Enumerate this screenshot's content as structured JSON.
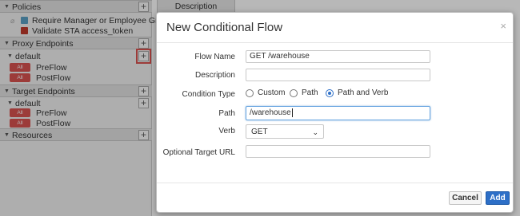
{
  "sidebar": {
    "policies_header": "Policies",
    "policies": [
      {
        "label": "Require Manager or Employee Gr...",
        "icon": "key-icon",
        "color": "#5ba0c4"
      },
      {
        "label": "Validate STA access_token",
        "icon": "lock-icon",
        "color": "#c0392b"
      }
    ],
    "proxy_endpoints_header": "Proxy Endpoints",
    "proxy_default": "default",
    "proxy_flows": [
      {
        "badge": "All",
        "label": "PreFlow"
      },
      {
        "badge": "All",
        "label": "PostFlow"
      }
    ],
    "target_endpoints_header": "Target Endpoints",
    "target_default": "default",
    "target_flows": [
      {
        "badge": "All",
        "label": "PreFlow"
      },
      {
        "badge": "All",
        "label": "PostFlow"
      }
    ],
    "resources_header": "Resources",
    "plus_symbol": "+"
  },
  "description_tab": "Description",
  "dialog": {
    "title": "New Conditional Flow",
    "close_symbol": "×",
    "flow_name_label": "Flow Name",
    "flow_name_value": "GET /warehouse",
    "description_label": "Description",
    "description_value": "",
    "condition_type_label": "Condition Type",
    "condition_options": [
      "Custom",
      "Path",
      "Path and Verb"
    ],
    "condition_selected": "Path and Verb",
    "path_label": "Path",
    "path_value": "/warehouse",
    "verb_label": "Verb",
    "verb_value": "GET",
    "optional_target_url_label": "Optional Target URL",
    "optional_target_url_value": "",
    "cancel_label": "Cancel",
    "add_label": "Add"
  },
  "colors": {
    "badge": "#d9534f",
    "primary": "#2d6fc7",
    "highlight": "#d9534f"
  }
}
